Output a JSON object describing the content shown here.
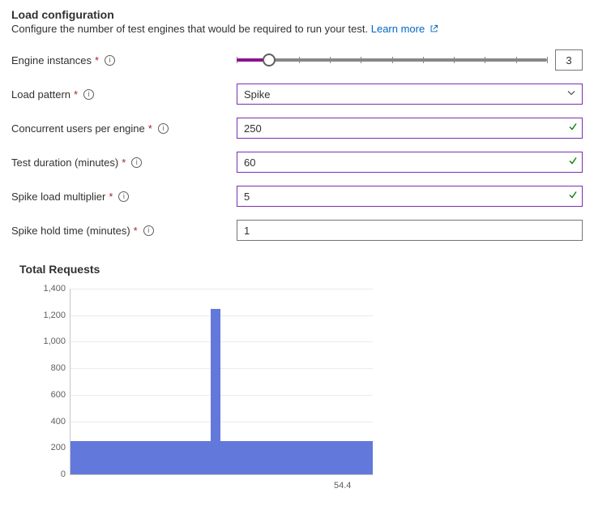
{
  "header": {
    "title": "Load configuration",
    "subtitle": "Configure the number of test engines that would be required to run your test.",
    "learn_more": "Learn more"
  },
  "form": {
    "engine_instances": {
      "label": "Engine instances",
      "value": "3"
    },
    "load_pattern": {
      "label": "Load pattern",
      "value": "Spike"
    },
    "concurrent_users": {
      "label": "Concurrent users per engine",
      "value": "250"
    },
    "test_duration": {
      "label": "Test duration (minutes)",
      "value": "60"
    },
    "spike_multiplier": {
      "label": "Spike load multiplier",
      "value": "5"
    },
    "spike_hold": {
      "label": "Spike hold time (minutes)",
      "value": "1"
    }
  },
  "slider": {
    "min": 1,
    "max": 20,
    "value": 3
  },
  "chart_title": "Total Requests",
  "chart_data": {
    "type": "bar",
    "title": "Total Requests",
    "xlabel": "",
    "ylabel": "",
    "categories": [
      54.4
    ],
    "values": [
      250
    ],
    "spike": {
      "x_fraction": 0.48,
      "value": 1250
    },
    "baseline": {
      "start_fraction": 0.0,
      "end_fraction": 1.0,
      "value": 250
    },
    "ylim": [
      0,
      1400
    ],
    "yticks": [
      0,
      200,
      400,
      600,
      800,
      1000,
      1200,
      1400
    ],
    "ytick_labels": [
      "0",
      "200",
      "400",
      "600",
      "800",
      "1,000",
      "1,200",
      "1,400"
    ],
    "xtick_label": "54.4"
  },
  "colors": {
    "accent_purple": "#7b2fb3",
    "slider_fill": "#8a1390",
    "link": "#0068c6",
    "bar": "#6378db",
    "valid": "#107c10"
  }
}
